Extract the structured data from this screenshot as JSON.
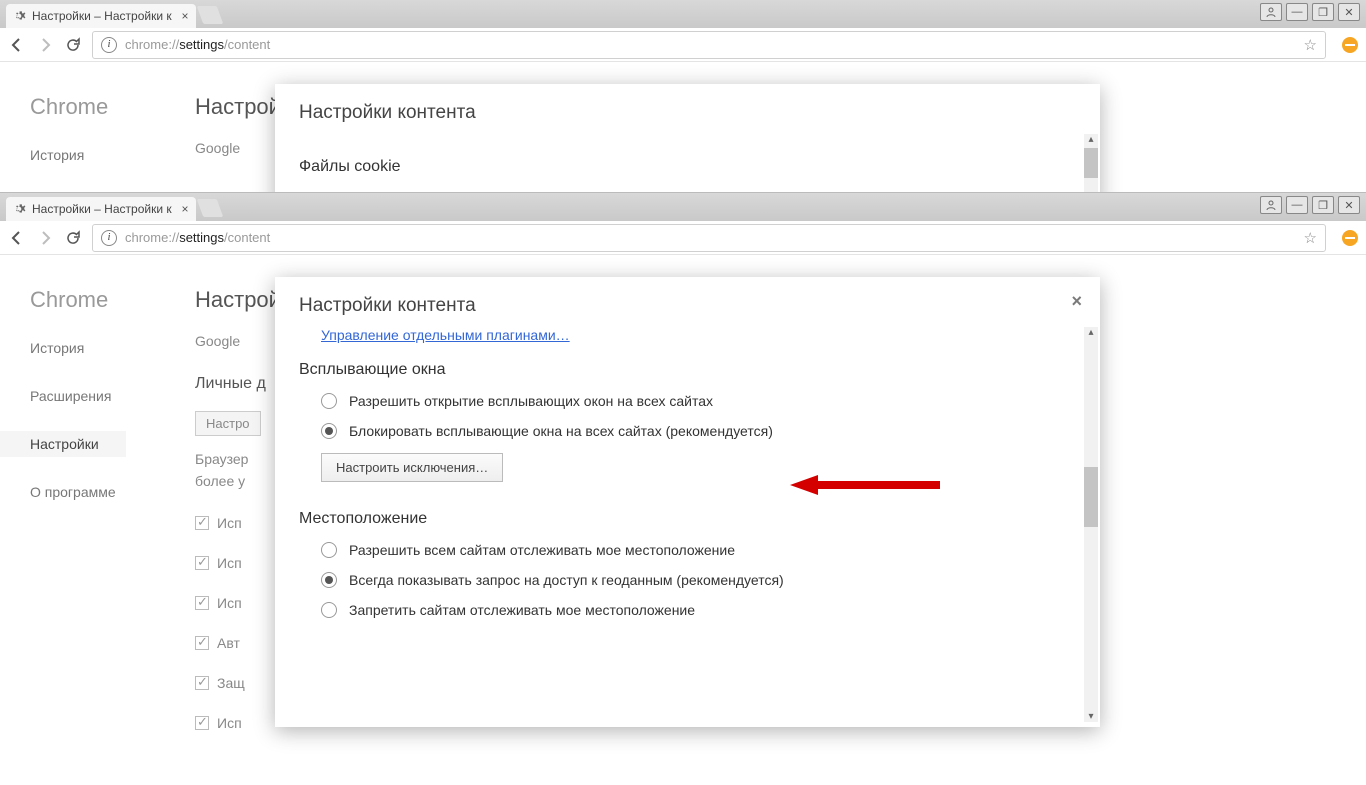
{
  "tab": {
    "title": "Настройки – Настройки к"
  },
  "url": {
    "gray1": "chrome://",
    "black": "settings",
    "gray2": "/content"
  },
  "brand": "Chrome",
  "sidebar": {
    "history": "История",
    "extensions": "Расширения",
    "settings": "Настройки",
    "about": "О программе"
  },
  "page_title_partial": "Настрой",
  "bg1": {
    "google": "Google",
    "personal": "Личные"
  },
  "bg2": {
    "personal": "Личные д",
    "browsers": "Браузер",
    "more": "более у",
    "btn": "Настро",
    "chk1": "Исп",
    "chk2": "Исп",
    "chk3": "Исп",
    "chk4": "Авт",
    "chk5": "Защ",
    "chk6": "Исп"
  },
  "modal": {
    "title": "Настройки контента",
    "cookies": "Файлы cookie",
    "plugins_link": "Управление отдельными плагинами…",
    "popups_title": "Всплывающие окна",
    "popups_allow": "Разрешить открытие всплывающих окон на всех сайтах",
    "popups_block": "Блокировать всплывающие окна на всех сайтах (рекомендуется)",
    "exceptions_btn": "Настроить исключения…",
    "location_title": "Местоположение",
    "loc_allow": "Разрешить всем сайтам отслеживать мое местоположение",
    "loc_ask": "Всегда показывать запрос на доступ к геоданным (рекомендуется)",
    "loc_deny": "Запретить сайтам отслеживать мое местоположение"
  }
}
